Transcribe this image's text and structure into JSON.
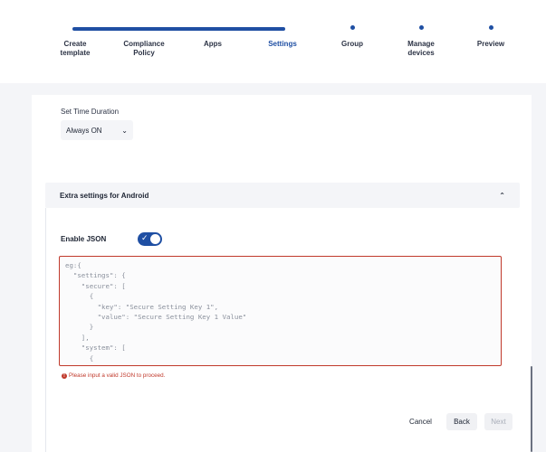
{
  "stepper": {
    "steps": [
      {
        "label": "Create\ntemplate"
      },
      {
        "label": "Compliance\nPolicy"
      },
      {
        "label": "Apps"
      },
      {
        "label": "Settings"
      },
      {
        "label": "Group"
      },
      {
        "label": "Manage\ndevices"
      },
      {
        "label": "Preview"
      }
    ],
    "active_index": 3,
    "completed_fraction": 0.43
  },
  "duration": {
    "label": "Set Time Duration",
    "value": "Always ON"
  },
  "accordion": {
    "title": "Extra settings for Android",
    "expanded": true
  },
  "json_settings": {
    "label": "Enable JSON",
    "enabled": true,
    "placeholder": "eg:{\n  \"settings\": {\n    \"secure\": [\n      {\n        \"key\": \"Secure Setting Key 1\",\n        \"value\": \"Secure Setting Key 1 Value\"\n      }\n    ],\n    \"system\": [\n      {",
    "error": "Please input a valid JSON to proceed."
  },
  "footer": {
    "cancel": "Cancel",
    "back": "Back",
    "next": "Next"
  },
  "colors": {
    "accent": "#1f4fa3",
    "error": "#c0392b"
  }
}
